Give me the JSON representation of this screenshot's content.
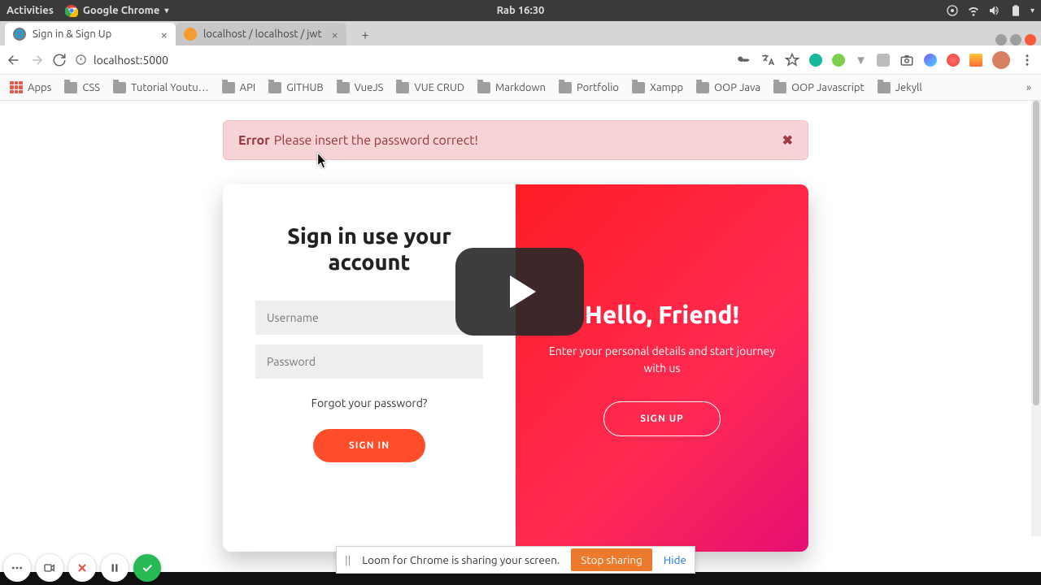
{
  "os": {
    "activities": "Activities",
    "app_name": "Google Chrome",
    "clock": "Rab 16:30"
  },
  "tabs": [
    {
      "title": "Sign in & Sign Up",
      "active": true
    },
    {
      "title": "localhost / localhost / jwt",
      "active": false
    }
  ],
  "url": "localhost:5000",
  "bookmarks": {
    "apps": "Apps",
    "items": [
      "CSS",
      "Tutorial Youtu…",
      "API",
      "GITHUB",
      "VueJS",
      "VUE CRUD",
      "Markdown",
      "Portfolio",
      "Xampp",
      "OOP Java",
      "OOP Javascript",
      "Jekyll"
    ]
  },
  "alert": {
    "title": "Error",
    "message": "Please insert the password correct!"
  },
  "signin": {
    "heading": "Sign in use your account",
    "username_placeholder": "Username",
    "password_placeholder": "Password",
    "forgot": "Forgot your password?",
    "button": "SIGN IN"
  },
  "signup": {
    "heading": "Hello, Friend!",
    "text": "Enter your personal details and start journey with us",
    "button": "SIGN UP"
  },
  "share": {
    "message": "Loom for Chrome is sharing your screen.",
    "stop": "Stop sharing",
    "hide": "Hide"
  }
}
